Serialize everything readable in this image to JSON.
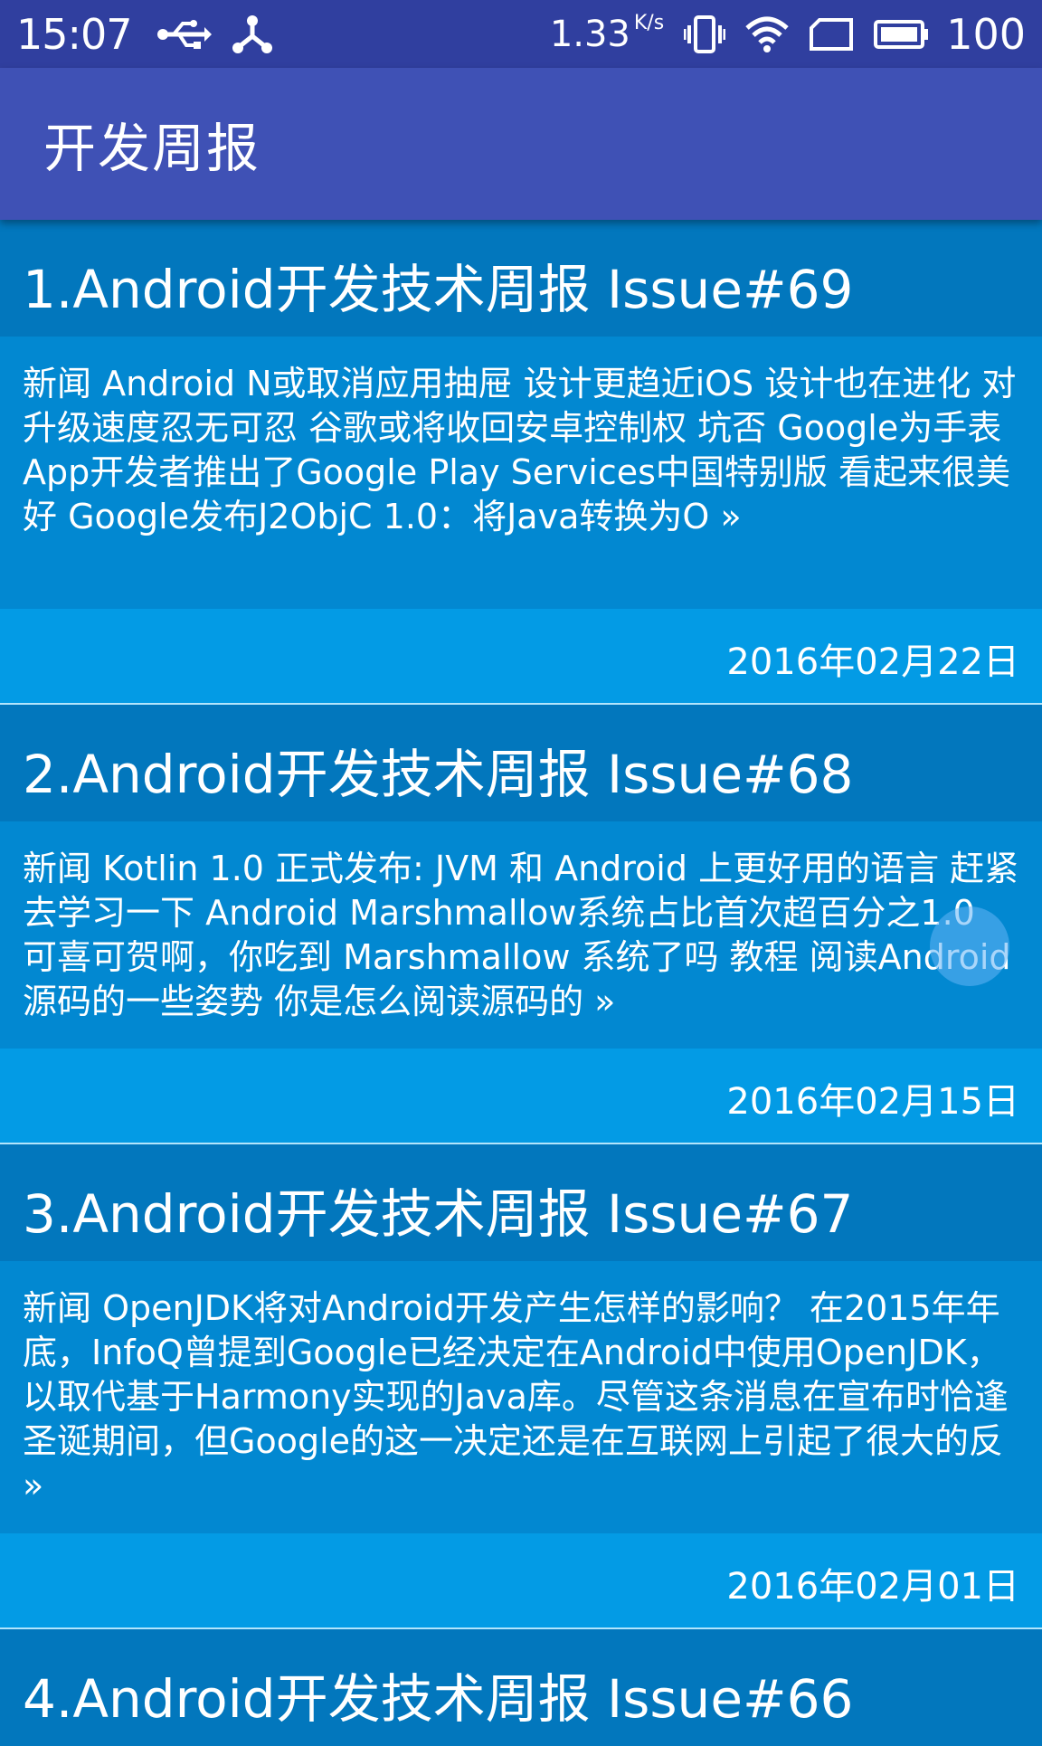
{
  "status_bar": {
    "time": "15:07",
    "net_speed_value": "1.33",
    "net_speed_unit": "K/s",
    "battery": "100",
    "icons": [
      "usb-icon",
      "share-icon",
      "vibrate-icon",
      "wifi-icon",
      "sim-card-icon",
      "battery-icon"
    ]
  },
  "app_bar": {
    "title": "开发周报"
  },
  "articles": [
    {
      "title": "1.Android开发技术周报 Issue#69",
      "summary": "新闻 Android N或取消应用抽屉 设计更趋近iOS 设计也在进化 对升级速度忍无可忍 谷歌或将收回安卓控制权 坑否 Google为手表App开发者推出了Google Play Services中国特别版 看起来很美好 Google发布J2ObjC 1.0：将Java转换为O »",
      "date": "2016年02月22日"
    },
    {
      "title": "2.Android开发技术周报 Issue#68",
      "summary": "新闻 Kotlin 1.0 正式发布: JVM 和 Android 上更好用的语言 赶紧去学习一下 Android Marshmallow系统占比首次超百分之1.0 可喜可贺啊，你吃到 Marshmallow 系统了吗 教程 阅读Android源码的一些姿势 你是怎么阅读源码的 »",
      "date": "2016年02月15日"
    },
    {
      "title": "3.Android开发技术周报 Issue#67",
      "summary": "新闻 OpenJDK将对Android开发产生怎样的影响？ 在2015年年底，InfoQ曾提到Google已经决定在Android中使用OpenJDK，以取代基于Harmony实现的Java库。尽管这条消息在宣布时恰逢圣诞期间，但Google的这一决定还是在互联网上引起了很大的反 »",
      "date": "2016年02月01日"
    },
    {
      "title": "4.Android开发技术周报 Issue#66"
    }
  ],
  "colors": {
    "status_bar": "#303F9F",
    "app_bar": "#3F51B5",
    "card_title_bg": "#0277BD",
    "card_summary_bg": "#0288D1",
    "card_date_bg": "#039BE5"
  }
}
